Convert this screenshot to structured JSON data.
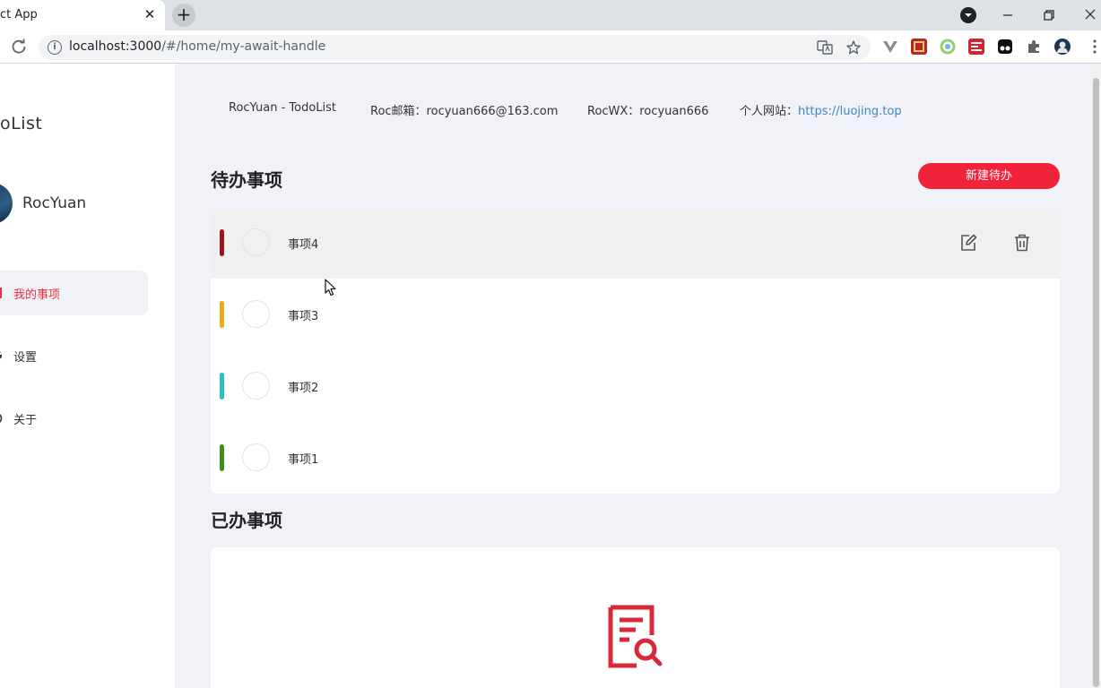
{
  "browser": {
    "tab_title": "ct App",
    "tab_close": "✕",
    "new_tab": "+",
    "url_host": "localhost:3000",
    "url_path": "/#/home/my-await-handle"
  },
  "sidebar": {
    "app_title": "oList",
    "username": "RocYuan",
    "items": [
      {
        "label": "我的事项",
        "active": true
      },
      {
        "label": "设置",
        "active": false
      },
      {
        "label": "关于",
        "active": false
      }
    ]
  },
  "info_bar": {
    "app_name": "RocYuan - TodoList",
    "email": "Roc邮箱：rocyuan666@163.com",
    "wx": "RocWX：rocyuan666",
    "site_label": "个人网站：",
    "site_url": "https://luojing.top"
  },
  "pending": {
    "title": "待办事项",
    "new_button": "新建待办",
    "items": [
      {
        "label": "事项4",
        "color": "#a0141e"
      },
      {
        "label": "事项3",
        "color": "#f0a81c"
      },
      {
        "label": "事项2",
        "color": "#2bbdc6"
      },
      {
        "label": "事项1",
        "color": "#3f8f1f"
      }
    ]
  },
  "done": {
    "title": "已办事项"
  },
  "colors": {
    "accent": "#f0233a",
    "link": "#3a89c9",
    "background": "#f1f2f7"
  }
}
